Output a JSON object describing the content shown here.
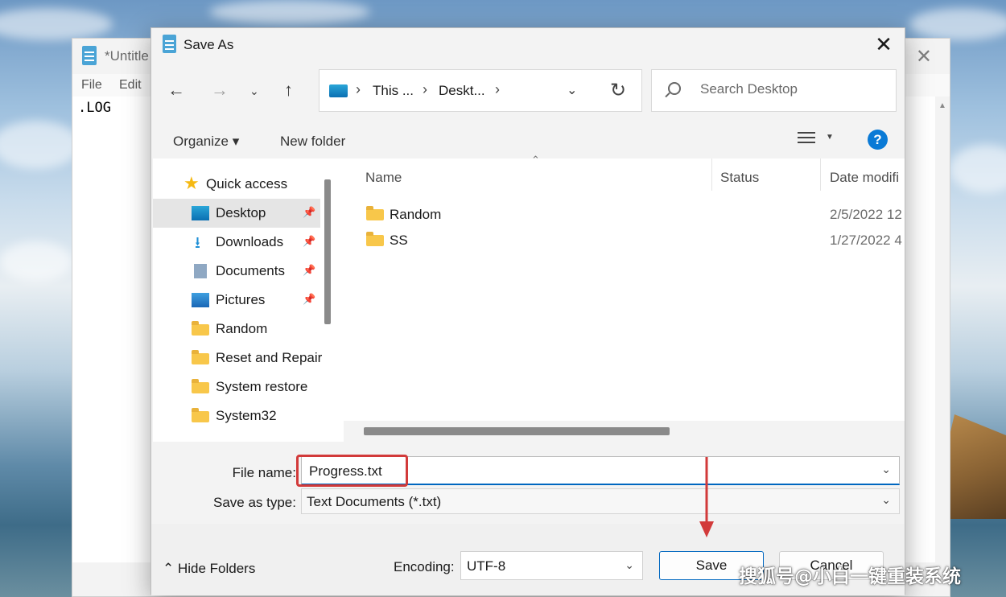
{
  "colors": {
    "accent": "#0067c0",
    "highlight": "#d23a3a",
    "folder": "#f8c74a",
    "help": "#0a7ad6"
  },
  "notepad": {
    "title": "*Untitle",
    "menu": [
      "File",
      "Edit"
    ],
    "content": ".LOG"
  },
  "dialog": {
    "title": "Save As",
    "nav": {
      "back_icon": "arrow-left-icon",
      "forward_icon": "arrow-right-icon",
      "recent_icon": "chevron-down-icon",
      "up_icon": "arrow-up-icon"
    },
    "breadcrumbs": [
      "This ...",
      "Deskt..."
    ],
    "search_placeholder": "Search Desktop",
    "toolbar": {
      "organize": "Organize ▾",
      "new_folder": "New folder"
    },
    "nav_pane": {
      "quick_access": "Quick access",
      "items": [
        {
          "label": "Desktop",
          "icon": "desktop-icon",
          "pinned": true,
          "selected": true
        },
        {
          "label": "Downloads",
          "icon": "download-icon",
          "pinned": true
        },
        {
          "label": "Documents",
          "icon": "documents-icon",
          "pinned": true
        },
        {
          "label": "Pictures",
          "icon": "pictures-icon",
          "pinned": true
        },
        {
          "label": "Random",
          "icon": "folder-icon"
        },
        {
          "label": "Reset and Repair",
          "icon": "folder-icon"
        },
        {
          "label": "System restore",
          "icon": "folder-icon"
        },
        {
          "label": "System32",
          "icon": "folder-icon"
        }
      ]
    },
    "columns": {
      "name": "Name",
      "status": "Status",
      "date": "Date modifi"
    },
    "files": [
      {
        "name": "Random",
        "date": "2/5/2022 12"
      },
      {
        "name": "SS",
        "date": "1/27/2022 4"
      }
    ],
    "file_name_label": "File name:",
    "file_name_value": "Progress.txt",
    "save_type_label": "Save as type:",
    "save_type_value": "Text Documents (*.txt)",
    "hide_folders": "Hide Folders",
    "encoding_label": "Encoding:",
    "encoding_value": "UTF-8",
    "save": "Save",
    "cancel": "Cancel"
  },
  "watermark": "搜狐号@小白一键重装系统"
}
